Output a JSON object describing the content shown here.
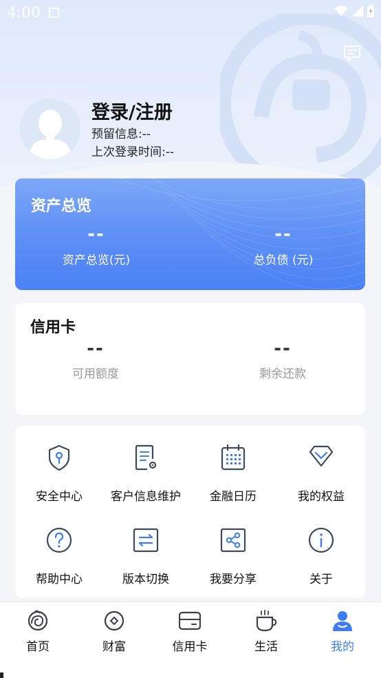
{
  "status_bar": {
    "time": "4:00"
  },
  "profile": {
    "login_title": "登录/注册",
    "reserved_info": "预留信息:--",
    "last_login": "上次登录时间:--"
  },
  "asset_overview": {
    "title": "资产总览",
    "total_assets_value": "--",
    "total_assets_label": "资产总览(元)",
    "total_debt_value": "--",
    "total_debt_label": "总负债 (元)"
  },
  "credit_card": {
    "title": "信用卡",
    "available_value": "--",
    "available_label": "可用额度",
    "remaining_value": "--",
    "remaining_label": "剩余还款"
  },
  "services": [
    {
      "label": "安全中心",
      "icon": "shield-icon"
    },
    {
      "label": "客户信息维护",
      "icon": "document-settings-icon"
    },
    {
      "label": "金融日历",
      "icon": "calendar-icon"
    },
    {
      "label": "我的权益",
      "icon": "diamond-icon"
    },
    {
      "label": "帮助中心",
      "icon": "question-icon"
    },
    {
      "label": "版本切换",
      "icon": "switch-icon"
    },
    {
      "label": "我要分享",
      "icon": "share-icon"
    },
    {
      "label": "关于",
      "icon": "info-icon"
    }
  ],
  "tabs": [
    {
      "label": "首页",
      "icon": "home-swirl-icon",
      "active": false
    },
    {
      "label": "财富",
      "icon": "wealth-icon",
      "active": false
    },
    {
      "label": "信用卡",
      "icon": "card-icon",
      "active": false
    },
    {
      "label": "生活",
      "icon": "coffee-cup-icon",
      "active": false
    },
    {
      "label": "我的",
      "icon": "person-icon",
      "active": true
    }
  ],
  "colors": {
    "accent": "#3f7bf5",
    "icon_stroke": "#3d4a5c",
    "card_gradient_top": "#7da8f7",
    "card_gradient_bottom": "#4c80f5"
  }
}
